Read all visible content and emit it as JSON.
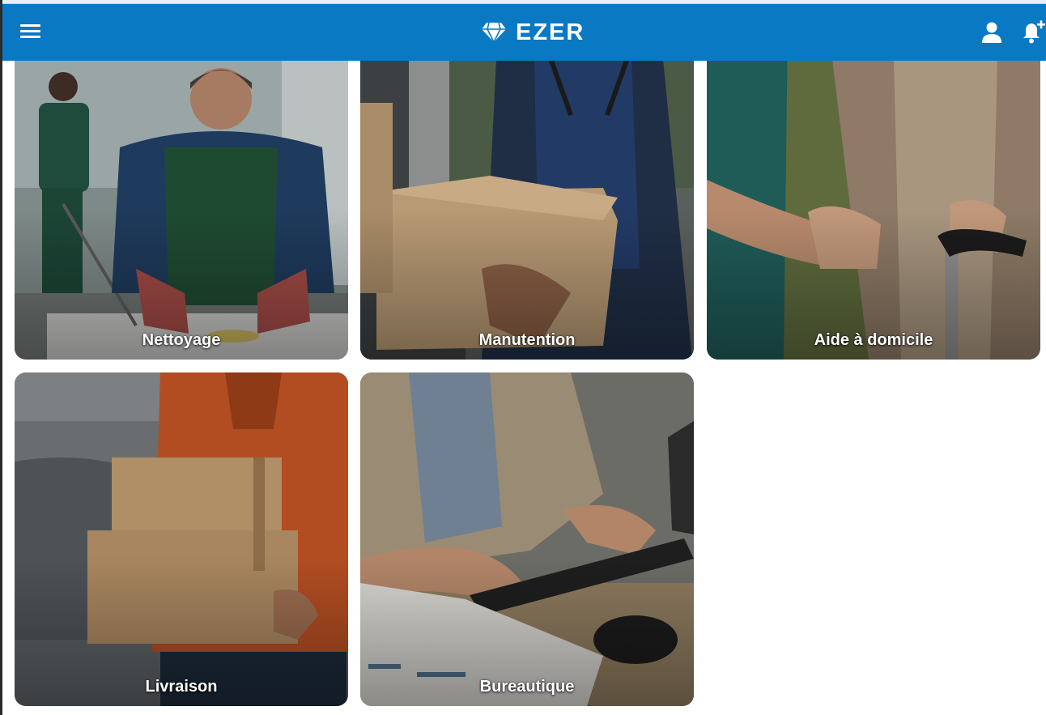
{
  "app": {
    "brand_name": "EZER",
    "accent_color": "#0a79c4"
  },
  "topbar": {
    "menu_icon": "hamburger-menu-icon",
    "brand_icon": "diamond-icon",
    "user_icon": "account-icon",
    "notifications_icon": "bell-plus-icon"
  },
  "categories": [
    {
      "label": "Nettoyage"
    },
    {
      "label": "Manutention"
    },
    {
      "label": "Aide à domicile"
    },
    {
      "label": "Livraison"
    },
    {
      "label": "Bureautique"
    }
  ]
}
